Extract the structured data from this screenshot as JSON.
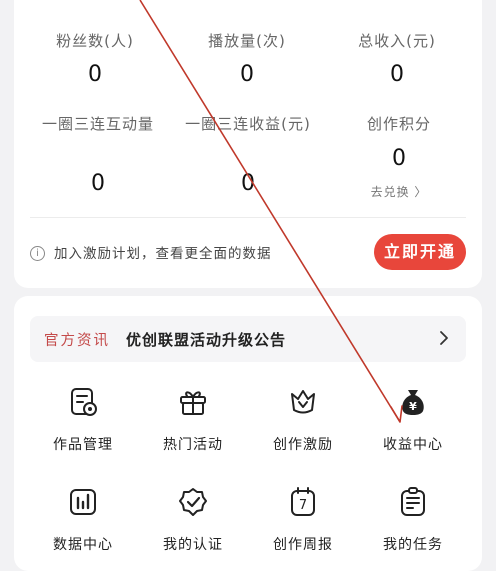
{
  "stats": {
    "fans_label": "粉丝数(人)",
    "fans_value": "0",
    "plays_label": "播放量(次)",
    "plays_value": "0",
    "income_label": "总收入(元)",
    "income_value": "0",
    "triple_interactions_label": "一圈三连互动量",
    "triple_interactions_value": "0",
    "triple_income_label": "一圈三连收益(元)",
    "triple_income_value": "0",
    "creation_points_label": "创作积分",
    "creation_points_value": "0",
    "redeem_label": "去兑换 〉"
  },
  "incentive": {
    "info_icon": "i",
    "text": "加入激励计划，查看更全面的数据",
    "button_label": "立即开通"
  },
  "news": {
    "tag": "官方资讯",
    "text": "优创联盟活动升级公告"
  },
  "functions": [
    {
      "label": "作品管理",
      "icon": "works-management-icon"
    },
    {
      "label": "热门活动",
      "icon": "gift-icon"
    },
    {
      "label": "创作激励",
      "icon": "crown-icon"
    },
    {
      "label": "收益中心",
      "icon": "money-bag-icon"
    },
    {
      "label": "数据中心",
      "icon": "chart-icon"
    },
    {
      "label": "我的认证",
      "icon": "verified-badge-icon"
    },
    {
      "label": "创作周报",
      "icon": "calendar-icon"
    },
    {
      "label": "我的任务",
      "icon": "task-list-icon"
    }
  ],
  "colors": {
    "accent": "#e8463b",
    "news_tag": "#c44a4a",
    "annotation_line": "#c0392b"
  }
}
